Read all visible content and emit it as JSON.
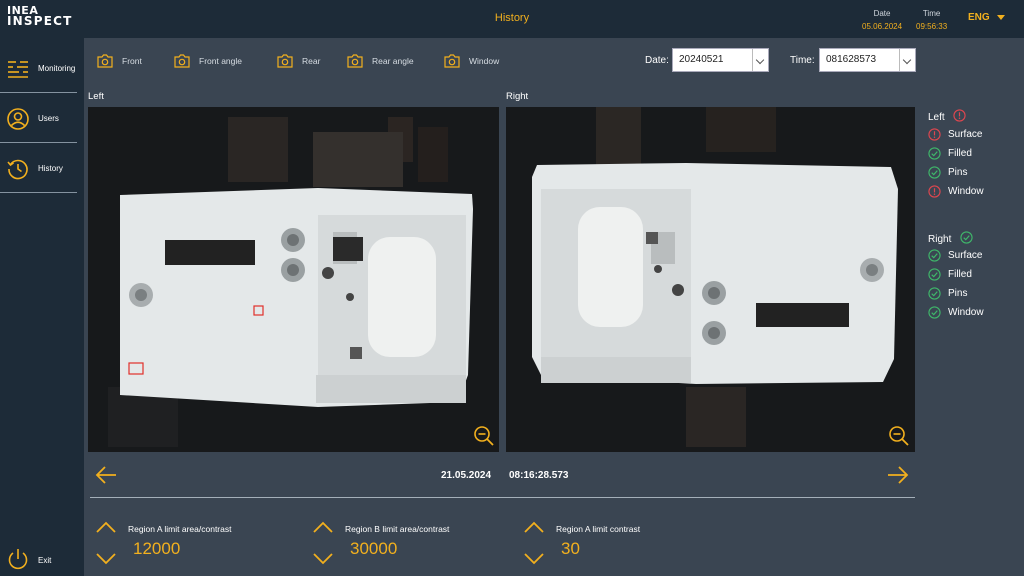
{
  "app": {
    "logo_line1": "INEA",
    "logo_line2": "INSPECT",
    "title": "History"
  },
  "header": {
    "date_label": "Date",
    "date_value": "05.06.2024",
    "time_label": "Time",
    "time_value": "09:56:33",
    "language": "ENG"
  },
  "sidebar": {
    "items": [
      {
        "label": "Monitoring",
        "icon": "monitoring-icon"
      },
      {
        "label": "Users",
        "icon": "user-icon"
      },
      {
        "label": "History",
        "icon": "history-icon"
      }
    ],
    "exit_label": "Exit"
  },
  "camera_tabs": [
    "Front",
    "Front angle",
    "Rear",
    "Rear angle",
    "Window"
  ],
  "filters": {
    "date_label": "Date:",
    "date_value": "20240521",
    "time_label": "Time:",
    "time_value": "081628573"
  },
  "panes": {
    "left_label": "Left",
    "right_label": "Right"
  },
  "results": {
    "left": {
      "title": "Left",
      "status": "fail",
      "checks": [
        {
          "name": "Surface",
          "status": "fail"
        },
        {
          "name": "Filled",
          "status": "ok"
        },
        {
          "name": "Pins",
          "status": "ok"
        },
        {
          "name": "Window",
          "status": "fail"
        }
      ]
    },
    "right": {
      "title": "Right",
      "status": "ok",
      "checks": [
        {
          "name": "Surface",
          "status": "ok"
        },
        {
          "name": "Filled",
          "status": "ok"
        },
        {
          "name": "Pins",
          "status": "ok"
        },
        {
          "name": "Window",
          "status": "ok"
        }
      ]
    }
  },
  "record": {
    "date": "21.05.2024",
    "time": "08:16:28.573"
  },
  "params": [
    {
      "label": "Region A limit area/contrast",
      "value": "12000"
    },
    {
      "label": "Region B limit area/contrast",
      "value": "30000"
    },
    {
      "label": "Region A limit contrast",
      "value": "30"
    }
  ],
  "colors": {
    "accent": "#f2b01e",
    "ok": "#3fb76a",
    "fail": "#e0464f",
    "background": "#3a4552",
    "bars": "#1d2b38"
  }
}
